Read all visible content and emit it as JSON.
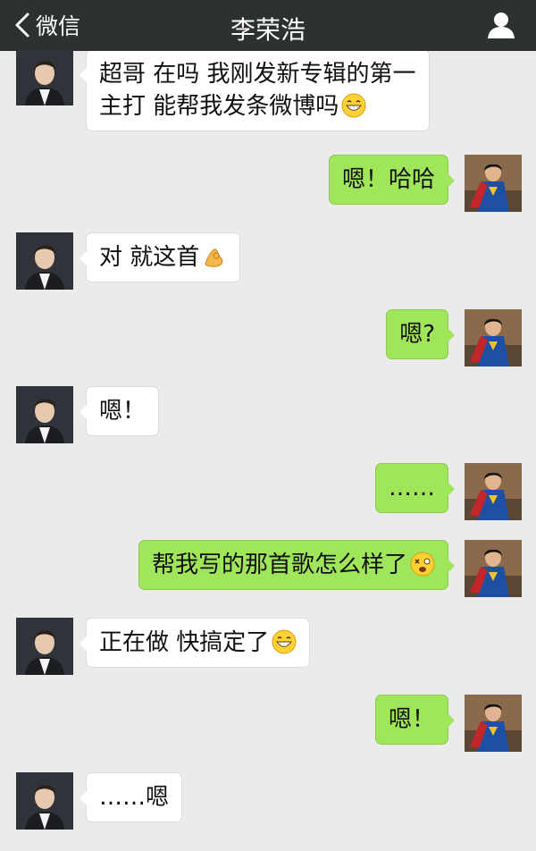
{
  "header": {
    "back_label": "微信",
    "title": "李荣浩"
  },
  "messages": [
    {
      "sender": "friend",
      "line1": "超哥 在吗 我刚发新专辑的第一",
      "line2": "主打 能帮我发条微博吗",
      "emoji": "grin-face"
    },
    {
      "sender": "me",
      "text": "嗯！哈哈"
    },
    {
      "sender": "friend",
      "text": "对 就这首",
      "emoji": "ok-hand"
    },
    {
      "sender": "me",
      "text": "嗯?"
    },
    {
      "sender": "friend",
      "text": "嗯！"
    },
    {
      "sender": "me",
      "text": "……"
    },
    {
      "sender": "me",
      "text": "帮我写的那首歌怎么样了",
      "emoji": "dizzy-face"
    },
    {
      "sender": "friend",
      "text": "正在做 快搞定了",
      "emoji": "grin-face"
    },
    {
      "sender": "me",
      "text": "嗯！"
    },
    {
      "sender": "friend",
      "text": "……嗯"
    }
  ],
  "colors": {
    "topbar": "#2e3132",
    "chat_bg": "#ebebeb",
    "my_bubble": "#9fe65b",
    "friend_bubble": "#ffffff"
  }
}
